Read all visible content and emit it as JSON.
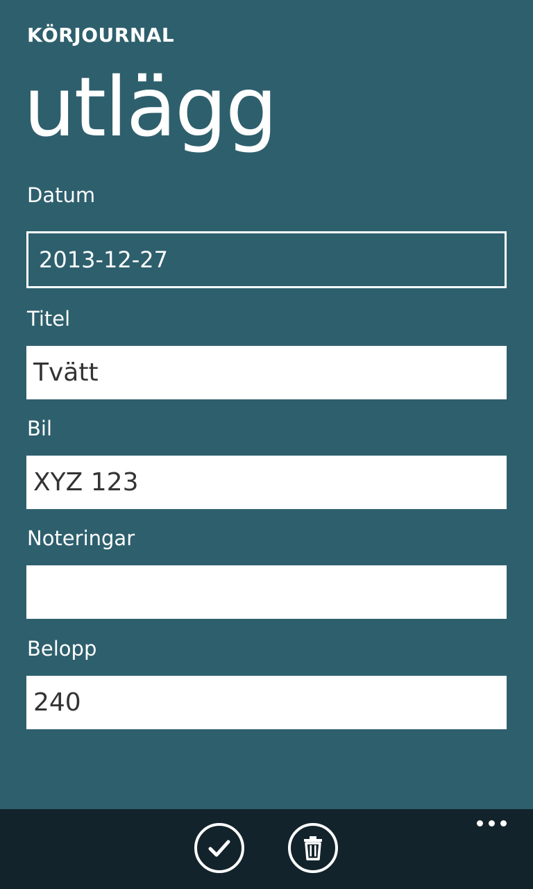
{
  "header": {
    "app_title": "KÖRJOURNAL",
    "page_title": "utlägg"
  },
  "form": {
    "date": {
      "label": "Datum",
      "value": "2013-12-27"
    },
    "title": {
      "label": "Titel",
      "value": "Tvätt"
    },
    "car": {
      "label": "Bil",
      "value": "XYZ 123"
    },
    "notes": {
      "label": "Noteringar",
      "value": ""
    },
    "amount": {
      "label": "Belopp",
      "value": "240"
    }
  },
  "app_bar": {
    "buttons": [
      {
        "icon": "check-icon"
      },
      {
        "icon": "trash-icon"
      }
    ],
    "more_icon": "ellipsis-icon"
  },
  "colors": {
    "background": "#2e5f6d",
    "app_bar": "#13232b",
    "foreground": "#ffffff"
  }
}
